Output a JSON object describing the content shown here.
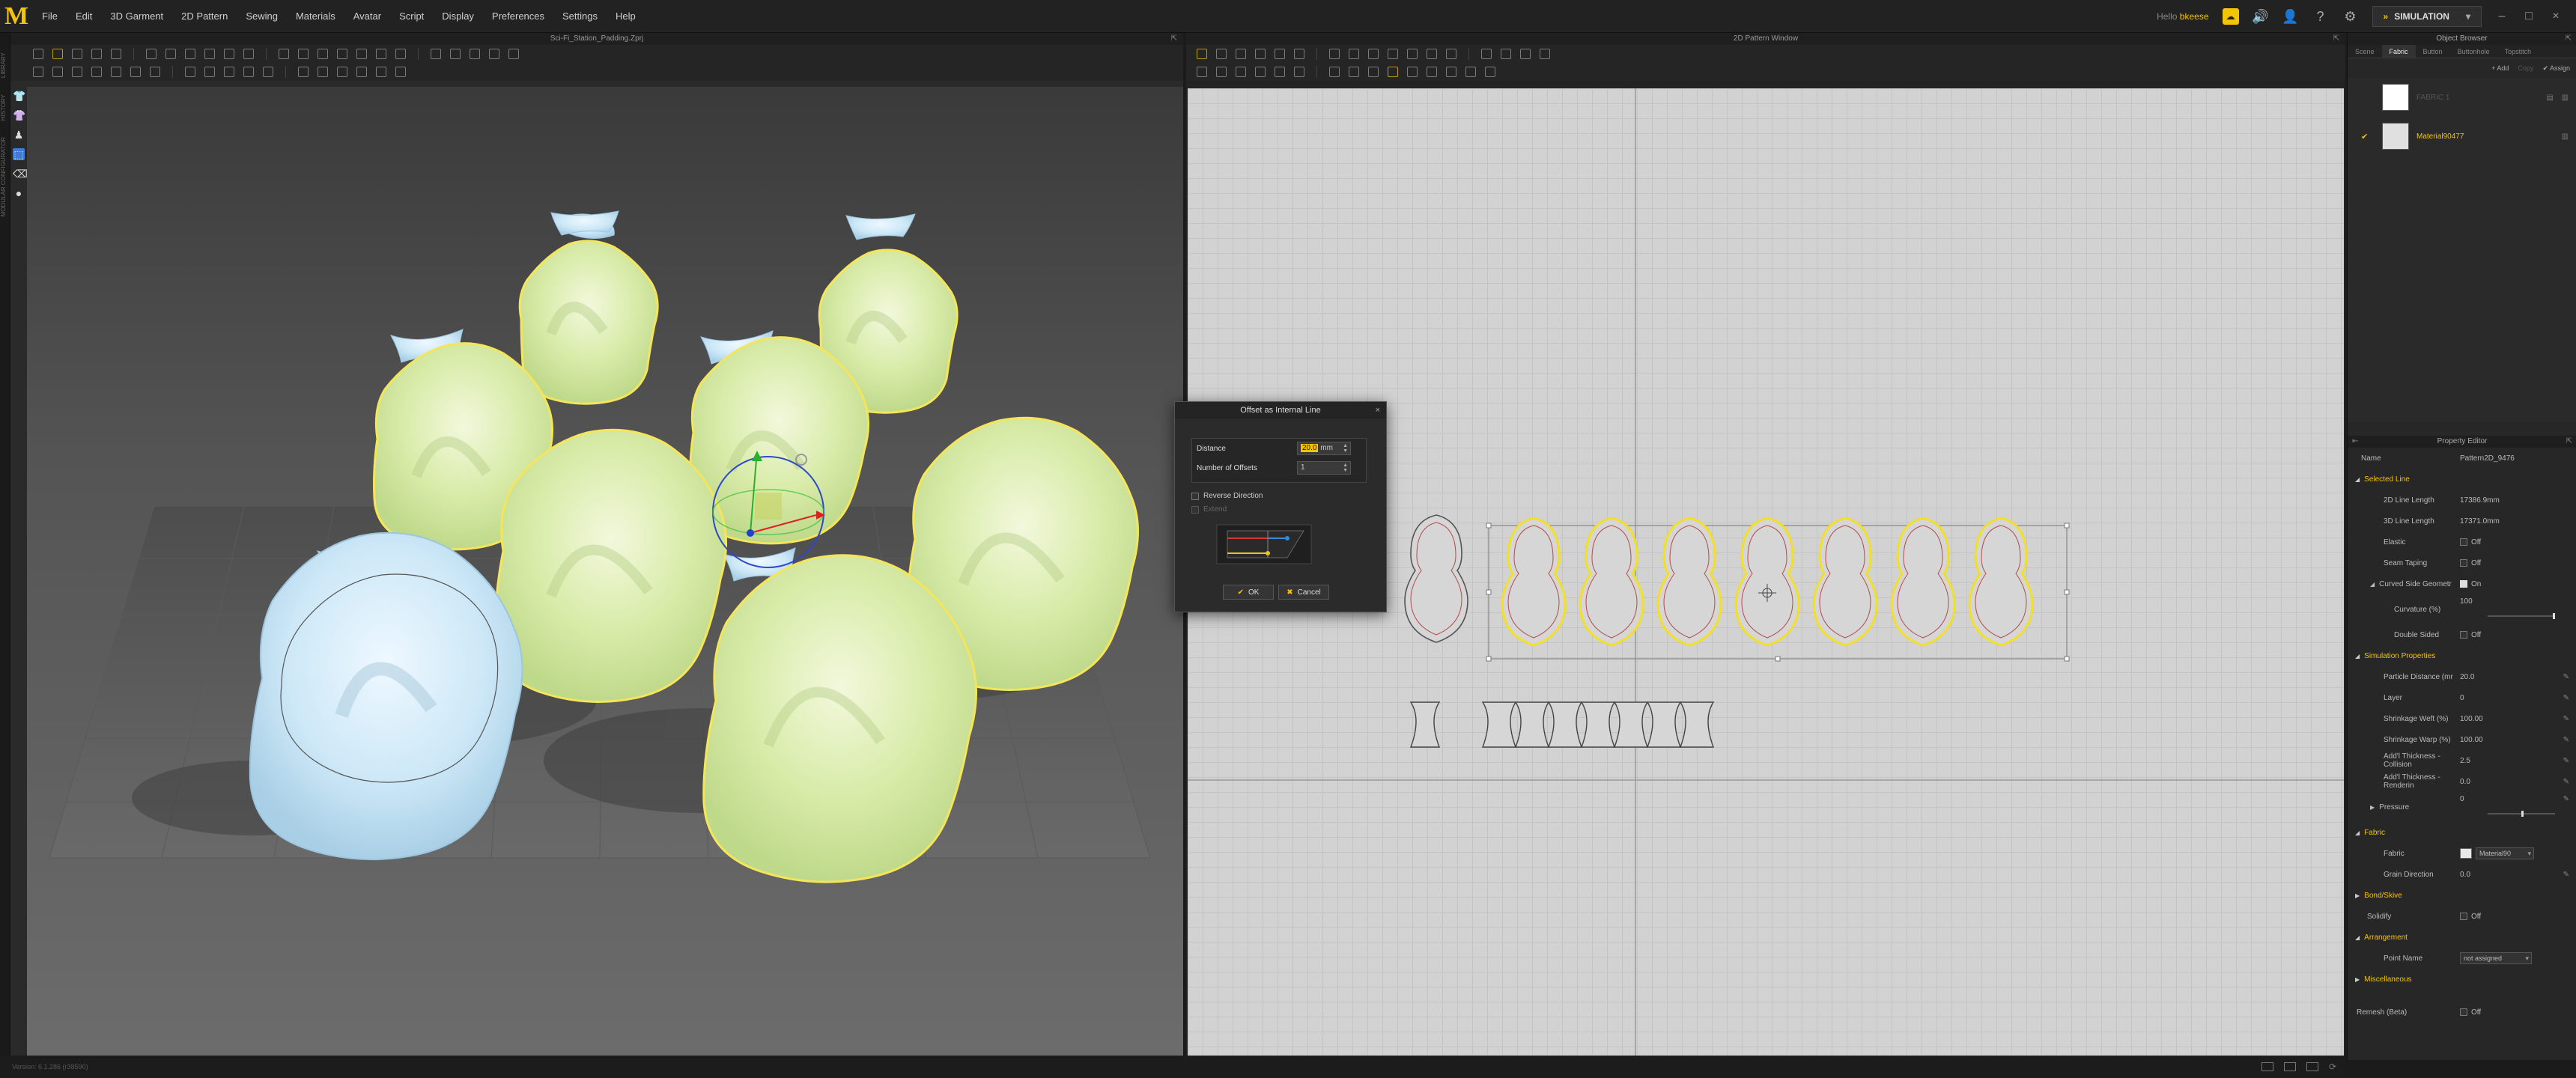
{
  "menubar": {
    "items": [
      "File",
      "Edit",
      "3D Garment",
      "2D Pattern",
      "Sewing",
      "Materials",
      "Avatar",
      "Script",
      "Display",
      "Preferences",
      "Settings",
      "Help"
    ],
    "hello_prefix": "Hello",
    "user": "bkeese",
    "simulation_label": "SIMULATION"
  },
  "sidebar": {
    "tabs": [
      "LIBRARY",
      "HISTORY",
      "MODULAR CONFIGURATOR"
    ]
  },
  "window3d": {
    "title": "Sci-Fi_Station_Padding.Zprj"
  },
  "window2d": {
    "title": "2D Pattern Window"
  },
  "dialog": {
    "title": "Offset as Internal Line",
    "distance_label": "Distance",
    "distance_value": "20.0",
    "distance_unit": "mm",
    "offsets_label": "Number of Offsets",
    "offsets_value": "1",
    "reverse_label": "Reverse Direction",
    "extend_label": "Extend",
    "ok_label": "OK",
    "cancel_label": "Cancel"
  },
  "object_browser": {
    "title": "Object Browser",
    "tabs": [
      "Scene",
      "Fabric",
      "Button",
      "Buttonhole",
      "Topstitch"
    ],
    "add_label": "+ Add",
    "copy_label": "Copy",
    "assign_label": "Assign",
    "items": [
      {
        "name": "FABRIC 1",
        "selected": false
      },
      {
        "name": "Material90477",
        "selected": true
      }
    ]
  },
  "property_editor": {
    "title": "Property Editor",
    "name_label": "Name",
    "name_value": "Pattern2D_9476",
    "sections": {
      "selected_line": "Selected Line",
      "simulation_properties": "Simulation Properties",
      "fabric": "Fabric",
      "bond_skive": "Bond/Skive",
      "arrangement": "Arrangement",
      "miscellaneous": "Miscellaneous"
    },
    "line2d_label": "2D Line Length",
    "line2d_value": "17386.9mm",
    "line3d_label": "3D Line Length",
    "line3d_value": "17371.0mm",
    "elastic_label": "Elastic",
    "elastic_value": "Off",
    "seam_label": "Seam Taping",
    "seam_value": "Off",
    "curved_label": "Curved Side Geometr",
    "curved_value": "On",
    "curvature_label": "Curvature (%)",
    "curvature_value": "100",
    "double_label": "Double Sided",
    "double_value": "Off",
    "particle_label": "Particle Distance (mr",
    "particle_value": "20.0",
    "layer_label": "Layer",
    "layer_value": "0",
    "weft_label": "Shrinkage Weft (%)",
    "weft_value": "100.00",
    "warp_label": "Shrinkage Warp (%)",
    "warp_value": "100.00",
    "collision_label": "Add'l Thickness - Collision",
    "collision_value": "2.5",
    "render_label": "Add'l Thickness - Renderin",
    "render_value": "0.0",
    "pressure_label": "Pressure",
    "pressure_value": "0",
    "fabric_label": "Fabric",
    "fabric_value": "Material90",
    "grain_label": "Grain Direction",
    "grain_value": "0.0",
    "solidify_label": "Solidify",
    "solidify_value": "Off",
    "point_label": "Point Name",
    "point_value": "not assigned",
    "remesh_label": "Remesh (Beta)",
    "remesh_value": "Off"
  },
  "status": {
    "text": "Version: 6.1.286 (r38590)"
  }
}
